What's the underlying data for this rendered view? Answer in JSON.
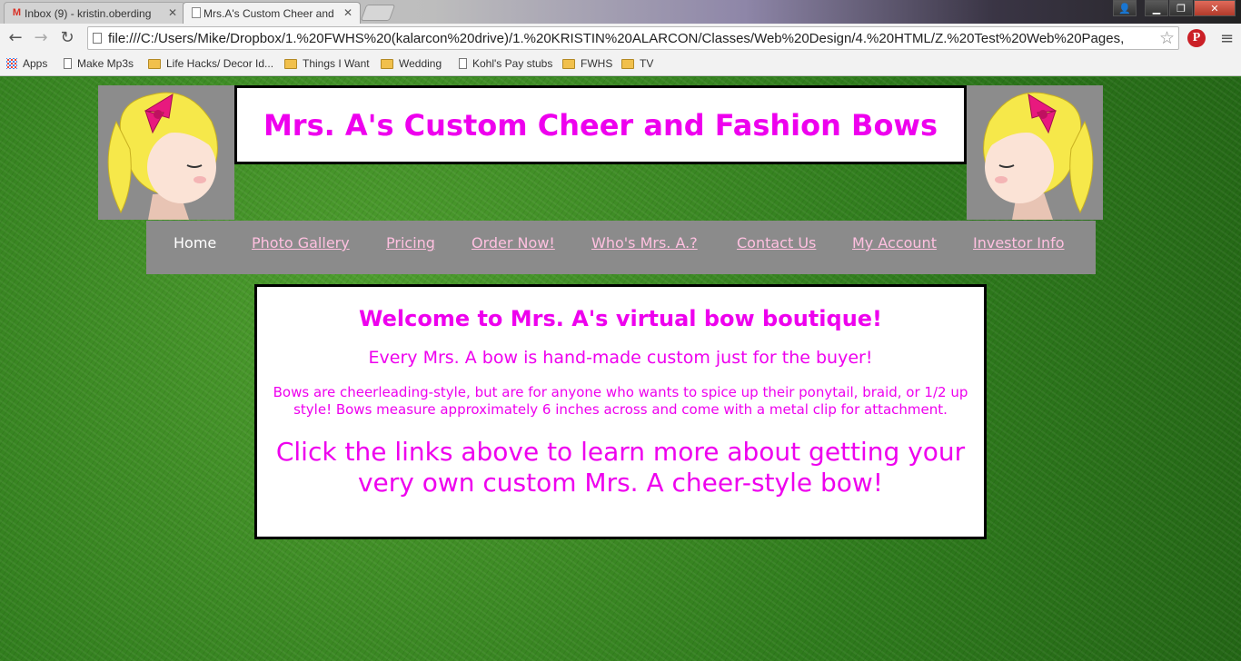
{
  "browser": {
    "tabs": [
      {
        "title": "Inbox (9) - kristin.oberding",
        "icon": "gmail-icon"
      },
      {
        "title": "Mrs.A's Custom Cheer and",
        "icon": "page-icon"
      }
    ],
    "address": "file:///C:/Users/Mike/Dropbox/1.%20FWHS%20(kalarcon%20drive)/1.%20KRISTIN%20ALARCON/Classes/Web%20Design/4.%20HTML/Z.%20Test%20Web%20Pages,",
    "bookmarks": [
      {
        "label": "Apps",
        "icon": "apps-icon"
      },
      {
        "label": "Make Mp3s",
        "icon": "page-icon"
      },
      {
        "label": "Life Hacks/ Decor Id...",
        "icon": "folder-icon"
      },
      {
        "label": "Things I Want",
        "icon": "folder-icon"
      },
      {
        "label": "Wedding",
        "icon": "folder-icon"
      },
      {
        "label": "Kohl's Pay stubs",
        "icon": "page-icon"
      },
      {
        "label": "FWHS",
        "icon": "folder-icon"
      },
      {
        "label": "TV",
        "icon": "folder-icon"
      }
    ]
  },
  "page": {
    "title": "Mrs. A's Custom Cheer and Fashion Bows",
    "nav": [
      "Home",
      "Photo Gallery",
      "Pricing",
      "Order Now!",
      "Who's Mrs. A.?",
      "Contact Us",
      "My Account",
      "Investor Info"
    ],
    "content": {
      "heading": "Welcome to Mrs. A's virtual bow boutique!",
      "p1": "Every Mrs. A bow is hand-made custom just for the buyer!",
      "p2": "Bows are cheerleading-style, but are for anyone who wants to spice up their ponytail, braid, or 1/2 up style! Bows measure approximately 6 inches across and come with a metal clip for attachment.",
      "p3": "Click the links above to learn more about getting your very own custom Mrs. A cheer-style bow!"
    }
  },
  "colors": {
    "accent_pink": "#ee00ee",
    "link_pink": "#ffc0e0",
    "nav_gray": "#8b8b8b"
  }
}
